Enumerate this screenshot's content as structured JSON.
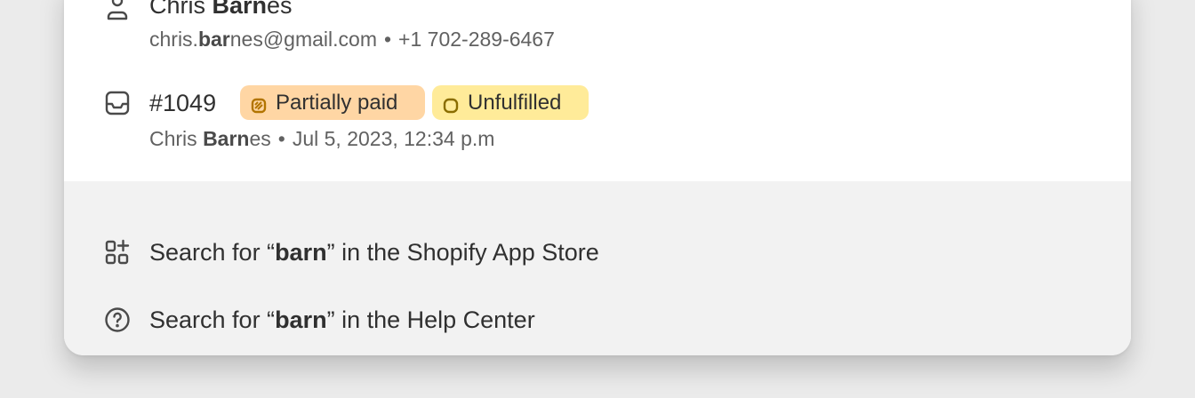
{
  "results": [
    {
      "type": "customer",
      "icon": "person-icon",
      "name_before": "Chris ",
      "name_match": "Barn",
      "name_after": "es",
      "email_before": "chris.",
      "email_match": "bar",
      "email_after": "nes@gmail.com",
      "separator": "•",
      "phone": "+1 702-289-6467"
    },
    {
      "type": "order",
      "icon": "inbox-icon",
      "order_number": "#1049",
      "badges": [
        {
          "label": "Partially paid",
          "color": "#ffd6a4",
          "icon": "partial-circle-icon"
        },
        {
          "label": "Unfulfilled",
          "color": "#ffeb99",
          "icon": "empty-circle-icon"
        }
      ],
      "customer_before": "Chris ",
      "customer_match": "Barn",
      "customer_after": "es",
      "separator": "•",
      "date": "Jul 5, 2023, 12:34 p.m"
    }
  ],
  "actions": [
    {
      "icon": "app-store-icon",
      "prefix": "Search for “",
      "query": "barn",
      "suffix": "” in the Shopify App Store"
    },
    {
      "icon": "help-circle-icon",
      "prefix": "Search for “",
      "query": "barn",
      "suffix": "” in the Help Center"
    }
  ],
  "colors": {
    "background": "#ebebeb",
    "panel": "#ffffff",
    "footer": "#f2f2f2",
    "text": "#303030",
    "subdued": "#616161"
  }
}
